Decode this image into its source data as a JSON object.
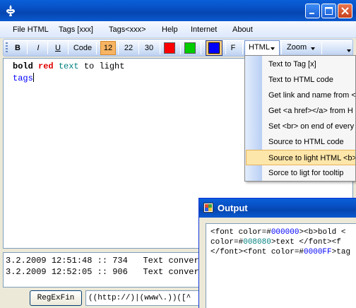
{
  "colors": {
    "title_bar": "#0a5fd8",
    "accent_orange": "#f7b463",
    "swatch_red": "#ff0000",
    "swatch_green": "#00cc00",
    "swatch_blue": "#0000ff",
    "text_red": "#e00000",
    "text_teal": "#008080",
    "text_blue": "#0000ff"
  },
  "window": {
    "icons": {
      "app": "fleur-de-lis-icon",
      "minimize": "minimize-icon",
      "maximize": "maximize-icon",
      "close": "close-icon"
    }
  },
  "menu": {
    "items": [
      "File HTML",
      "Tags [xxx]",
      "Tags<xxx>",
      "Help",
      "Internet",
      "About"
    ]
  },
  "toolbar": {
    "bold": "B",
    "italic": "I",
    "underline": "U",
    "code": "Code",
    "size_12": "12",
    "size_22": "22",
    "size_30": "30",
    "font": "F",
    "html": "HTML",
    "zoom": "Zoom",
    "active_size": "12"
  },
  "editor": {
    "words": {
      "bold": "bold",
      "red": "red",
      "text": "text",
      "to": "to",
      "light": "light",
      "tags": "tags"
    }
  },
  "html_menu": {
    "items": [
      "Text to Tag [x]",
      "Text to HTML code",
      "Get link and name from <a",
      "Get <a href></a> from H",
      "Set <br> on end of every",
      "Source to HTML code",
      "Source to light HTML <b>",
      "Sorce to ligt for tooltip"
    ],
    "selected_index": 6
  },
  "log": {
    "rows": [
      {
        "date": "3.2.2009",
        "time": "12:51:48",
        "sep": "::",
        "count": "734",
        "msg": "Text convert"
      },
      {
        "date": "3.2.2009",
        "time": "12:52:05",
        "sep": "::",
        "count": "906",
        "msg": "Text convert"
      }
    ]
  },
  "bottom": {
    "regex_button": "RegExFin",
    "regex_value": "((http://)|(www\\.))([^"
  },
  "output": {
    "title": "Output",
    "line1_pre": "<font color=#",
    "line1_num": "000000",
    "line1_post": "><b>bold <",
    "line2_pre": "color=#",
    "line2_num": "008080",
    "line2_post": ">text </font><f",
    "line3_pre": "</font><font color=#",
    "line3_num": "0000FF",
    "line3_post": ">tag"
  }
}
